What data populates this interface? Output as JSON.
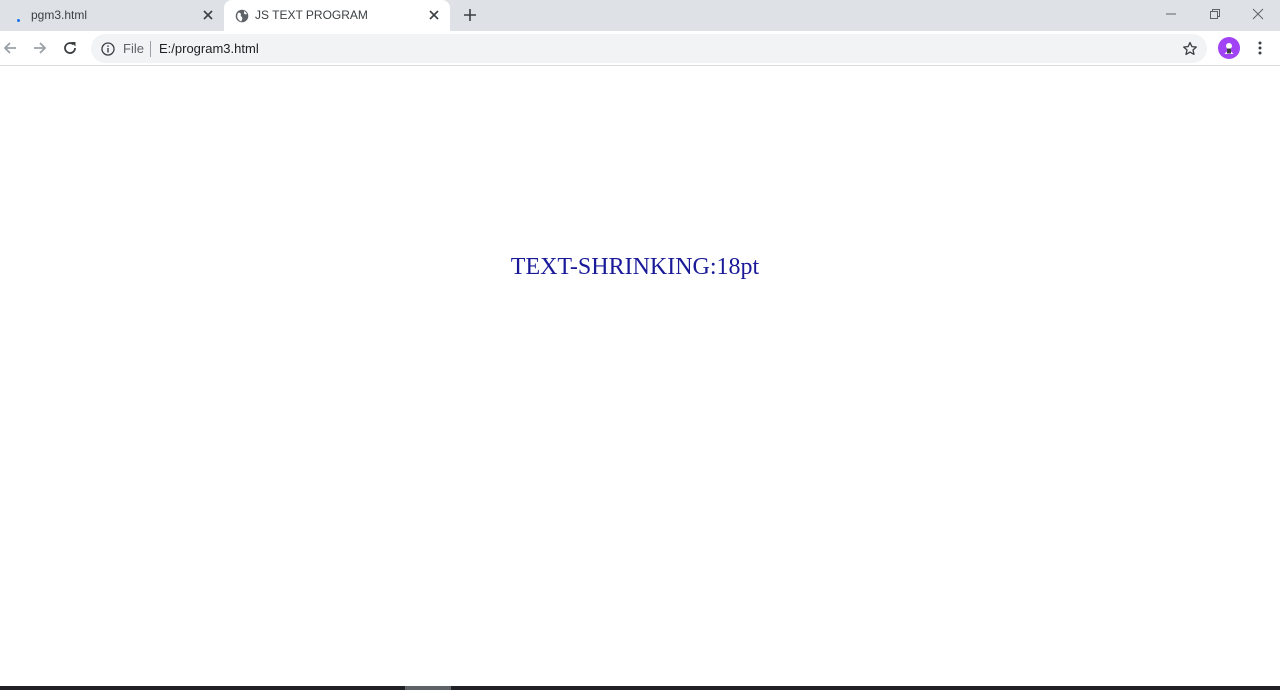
{
  "tabs": [
    {
      "title": "pgm3.html",
      "favicon": "loading-dot-icon",
      "active": false
    },
    {
      "title": "JS TEXT PROGRAM",
      "favicon": "globe-icon",
      "active": true
    }
  ],
  "toolbar": {
    "scheme_label": "File",
    "url": "E:/program3.html"
  },
  "page": {
    "text": "TEXT-SHRINKING:18pt",
    "text_color": "#1a1a99"
  },
  "colors": {
    "tabstrip_bg": "#dee1e6",
    "profile_bg": "#a142f4",
    "loading_dot": "#1a73e8"
  }
}
